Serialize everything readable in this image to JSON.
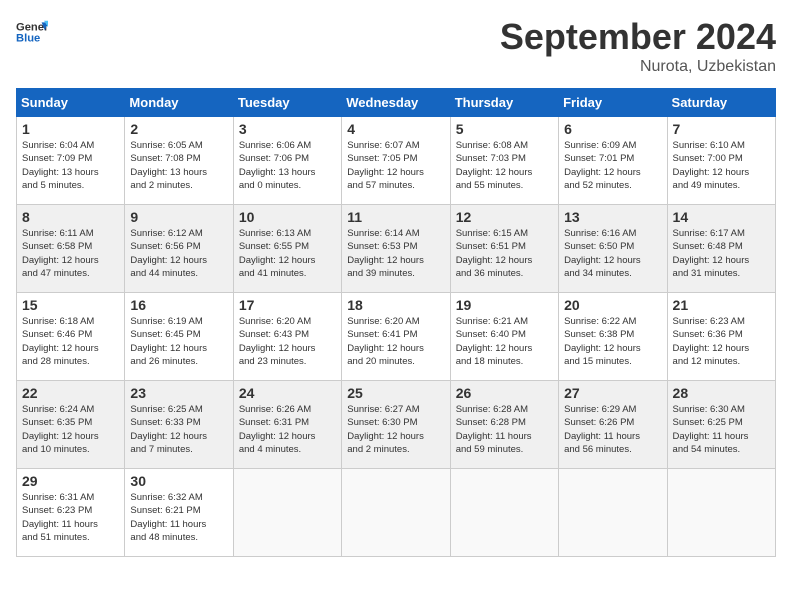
{
  "header": {
    "logo_general": "General",
    "logo_blue": "Blue",
    "month_title": "September 2024",
    "location": "Nurota, Uzbekistan"
  },
  "weekdays": [
    "Sunday",
    "Monday",
    "Tuesday",
    "Wednesday",
    "Thursday",
    "Friday",
    "Saturday"
  ],
  "weeks": [
    [
      {
        "day": "1",
        "info": "Sunrise: 6:04 AM\nSunset: 7:09 PM\nDaylight: 13 hours\nand 5 minutes."
      },
      {
        "day": "2",
        "info": "Sunrise: 6:05 AM\nSunset: 7:08 PM\nDaylight: 13 hours\nand 2 minutes."
      },
      {
        "day": "3",
        "info": "Sunrise: 6:06 AM\nSunset: 7:06 PM\nDaylight: 13 hours\nand 0 minutes."
      },
      {
        "day": "4",
        "info": "Sunrise: 6:07 AM\nSunset: 7:05 PM\nDaylight: 12 hours\nand 57 minutes."
      },
      {
        "day": "5",
        "info": "Sunrise: 6:08 AM\nSunset: 7:03 PM\nDaylight: 12 hours\nand 55 minutes."
      },
      {
        "day": "6",
        "info": "Sunrise: 6:09 AM\nSunset: 7:01 PM\nDaylight: 12 hours\nand 52 minutes."
      },
      {
        "day": "7",
        "info": "Sunrise: 6:10 AM\nSunset: 7:00 PM\nDaylight: 12 hours\nand 49 minutes."
      }
    ],
    [
      {
        "day": "8",
        "info": "Sunrise: 6:11 AM\nSunset: 6:58 PM\nDaylight: 12 hours\nand 47 minutes."
      },
      {
        "day": "9",
        "info": "Sunrise: 6:12 AM\nSunset: 6:56 PM\nDaylight: 12 hours\nand 44 minutes."
      },
      {
        "day": "10",
        "info": "Sunrise: 6:13 AM\nSunset: 6:55 PM\nDaylight: 12 hours\nand 41 minutes."
      },
      {
        "day": "11",
        "info": "Sunrise: 6:14 AM\nSunset: 6:53 PM\nDaylight: 12 hours\nand 39 minutes."
      },
      {
        "day": "12",
        "info": "Sunrise: 6:15 AM\nSunset: 6:51 PM\nDaylight: 12 hours\nand 36 minutes."
      },
      {
        "day": "13",
        "info": "Sunrise: 6:16 AM\nSunset: 6:50 PM\nDaylight: 12 hours\nand 34 minutes."
      },
      {
        "day": "14",
        "info": "Sunrise: 6:17 AM\nSunset: 6:48 PM\nDaylight: 12 hours\nand 31 minutes."
      }
    ],
    [
      {
        "day": "15",
        "info": "Sunrise: 6:18 AM\nSunset: 6:46 PM\nDaylight: 12 hours\nand 28 minutes."
      },
      {
        "day": "16",
        "info": "Sunrise: 6:19 AM\nSunset: 6:45 PM\nDaylight: 12 hours\nand 26 minutes."
      },
      {
        "day": "17",
        "info": "Sunrise: 6:20 AM\nSunset: 6:43 PM\nDaylight: 12 hours\nand 23 minutes."
      },
      {
        "day": "18",
        "info": "Sunrise: 6:20 AM\nSunset: 6:41 PM\nDaylight: 12 hours\nand 20 minutes."
      },
      {
        "day": "19",
        "info": "Sunrise: 6:21 AM\nSunset: 6:40 PM\nDaylight: 12 hours\nand 18 minutes."
      },
      {
        "day": "20",
        "info": "Sunrise: 6:22 AM\nSunset: 6:38 PM\nDaylight: 12 hours\nand 15 minutes."
      },
      {
        "day": "21",
        "info": "Sunrise: 6:23 AM\nSunset: 6:36 PM\nDaylight: 12 hours\nand 12 minutes."
      }
    ],
    [
      {
        "day": "22",
        "info": "Sunrise: 6:24 AM\nSunset: 6:35 PM\nDaylight: 12 hours\nand 10 minutes."
      },
      {
        "day": "23",
        "info": "Sunrise: 6:25 AM\nSunset: 6:33 PM\nDaylight: 12 hours\nand 7 minutes."
      },
      {
        "day": "24",
        "info": "Sunrise: 6:26 AM\nSunset: 6:31 PM\nDaylight: 12 hours\nand 4 minutes."
      },
      {
        "day": "25",
        "info": "Sunrise: 6:27 AM\nSunset: 6:30 PM\nDaylight: 12 hours\nand 2 minutes."
      },
      {
        "day": "26",
        "info": "Sunrise: 6:28 AM\nSunset: 6:28 PM\nDaylight: 11 hours\nand 59 minutes."
      },
      {
        "day": "27",
        "info": "Sunrise: 6:29 AM\nSunset: 6:26 PM\nDaylight: 11 hours\nand 56 minutes."
      },
      {
        "day": "28",
        "info": "Sunrise: 6:30 AM\nSunset: 6:25 PM\nDaylight: 11 hours\nand 54 minutes."
      }
    ],
    [
      {
        "day": "29",
        "info": "Sunrise: 6:31 AM\nSunset: 6:23 PM\nDaylight: 11 hours\nand 51 minutes."
      },
      {
        "day": "30",
        "info": "Sunrise: 6:32 AM\nSunset: 6:21 PM\nDaylight: 11 hours\nand 48 minutes."
      },
      {
        "day": "",
        "info": ""
      },
      {
        "day": "",
        "info": ""
      },
      {
        "day": "",
        "info": ""
      },
      {
        "day": "",
        "info": ""
      },
      {
        "day": "",
        "info": ""
      }
    ]
  ]
}
